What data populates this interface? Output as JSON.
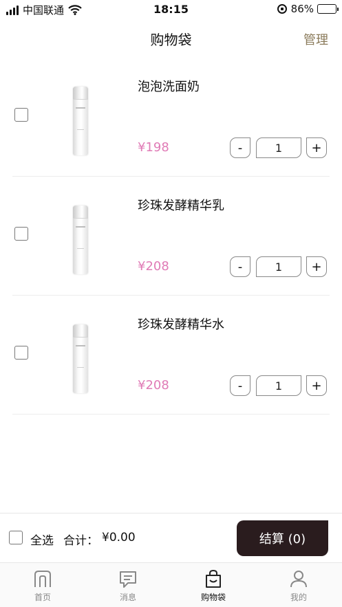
{
  "status_bar": {
    "carrier": "中国联通",
    "time": "18:15",
    "battery_percent": "86%",
    "battery_level": 0.86
  },
  "nav": {
    "title": "购物袋",
    "manage_label": "管理"
  },
  "cart": {
    "items": [
      {
        "name": "泡泡洗面奶",
        "price": "¥198",
        "quantity": "1",
        "minus_label": "-",
        "plus_label": "+"
      },
      {
        "name": "珍珠发酵精华乳",
        "price": "¥208",
        "quantity": "1",
        "minus_label": "-",
        "plus_label": "+"
      },
      {
        "name": "珍珠发酵精华水",
        "price": "¥208",
        "quantity": "1",
        "minus_label": "-",
        "plus_label": "+"
      }
    ]
  },
  "bottom_bar": {
    "select_all_label": "全选",
    "total_label": "合计：",
    "total_value": "¥0.00",
    "checkout_label": "结算 (0)"
  },
  "tabs": [
    {
      "label": "首页",
      "icon": "home-icon"
    },
    {
      "label": "消息",
      "icon": "message-icon"
    },
    {
      "label": "购物袋",
      "icon": "shopping-bag-icon",
      "active": true
    },
    {
      "label": "我的",
      "icon": "profile-icon"
    }
  ],
  "colors": {
    "price": "#e07bb6",
    "manage": "#8a7a5a",
    "checkout_bg": "#2a1c1e",
    "battery_fill": "#4cd964"
  }
}
